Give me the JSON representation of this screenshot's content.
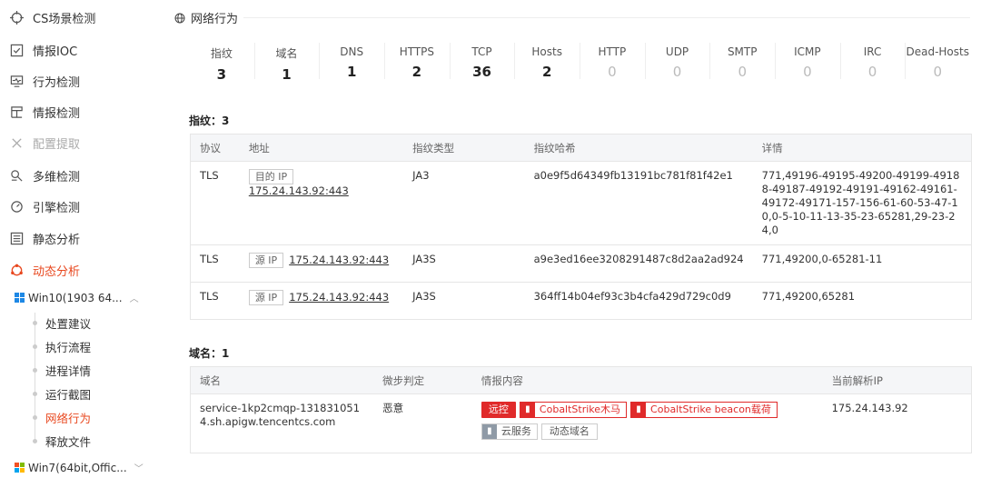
{
  "sidebar": {
    "items": [
      {
        "label": "CS场景检测",
        "icon": "crosshair-icon"
      },
      {
        "label": "情报IOC",
        "icon": "checkbox-icon"
      },
      {
        "label": "行为检测",
        "icon": "monitor-icon"
      },
      {
        "label": "情报检测",
        "icon": "layout-icon"
      },
      {
        "label": "配置提取",
        "icon": "tools-icon"
      },
      {
        "label": "多维检测",
        "icon": "multi-icon"
      },
      {
        "label": "引擎检测",
        "icon": "gauge-icon"
      },
      {
        "label": "静态分析",
        "icon": "list-icon"
      },
      {
        "label": "动态分析",
        "icon": "dynamic-icon"
      }
    ],
    "os1": "Win10(1903 64...",
    "os2": "Win7(64bit,Offic...",
    "tree": [
      "处置建议",
      "执行流程",
      "进程详情",
      "运行截图",
      "网络行为",
      "释放文件"
    ]
  },
  "main": {
    "title": "网络行为",
    "stats": [
      {
        "label": "指纹",
        "value": "3"
      },
      {
        "label": "域名",
        "value": "1"
      },
      {
        "label": "DNS",
        "value": "1"
      },
      {
        "label": "HTTPS",
        "value": "2"
      },
      {
        "label": "TCP",
        "value": "36"
      },
      {
        "label": "Hosts",
        "value": "2"
      },
      {
        "label": "HTTP",
        "value": "0"
      },
      {
        "label": "UDP",
        "value": "0"
      },
      {
        "label": "SMTP",
        "value": "0"
      },
      {
        "label": "ICMP",
        "value": "0"
      },
      {
        "label": "IRC",
        "value": "0"
      },
      {
        "label": "Dead-Hosts",
        "value": "0"
      }
    ],
    "fingerprint": {
      "heading": "指纹：3",
      "headers": [
        "协议",
        "地址",
        "指纹类型",
        "指纹哈希",
        "详情"
      ],
      "rows": [
        {
          "proto": "TLS",
          "ip_tag": "目的 IP",
          "addr": "175.24.143.92:443",
          "type": "JA3",
          "hash": "a0e9f5d64349fb13191bc781f81f42e1",
          "detail": "771,49196-49195-49200-49199-49188-49187-49192-49191-49162-49161-49172-49171-157-156-61-60-53-47-10,0-5-10-11-13-35-23-65281,29-23-24,0"
        },
        {
          "proto": "TLS",
          "ip_tag": "源 IP",
          "addr": "175.24.143.92:443",
          "type": "JA3S",
          "hash": "a9e3ed16ee3208291487c8d2aa2ad924",
          "detail": "771,49200,0-65281-11"
        },
        {
          "proto": "TLS",
          "ip_tag": "源 IP",
          "addr": "175.24.143.92:443",
          "type": "JA3S",
          "hash": "364ff14b04ef93c3b4cfa429d729c0d9",
          "detail": "771,49200,65281"
        }
      ]
    },
    "domain": {
      "heading": "域名：1",
      "headers": [
        "域名",
        "微步判定",
        "情报内容",
        "当前解析IP"
      ],
      "row": {
        "name": "service-1kp2cmqp-1318310514.sh.apigw.tencentcs.com",
        "verdict": "恶意",
        "tags_red": "远控",
        "tag_cs1": "CobaltStrike木马",
        "tag_cs2": "CobaltStrike beacon载荷",
        "tag_cloud": "云服务",
        "tag_dyn": "动态域名",
        "ip": "175.24.143.92"
      }
    }
  },
  "colors": {
    "accent": "#e8481f",
    "danger_badge": "#e02a2a"
  }
}
